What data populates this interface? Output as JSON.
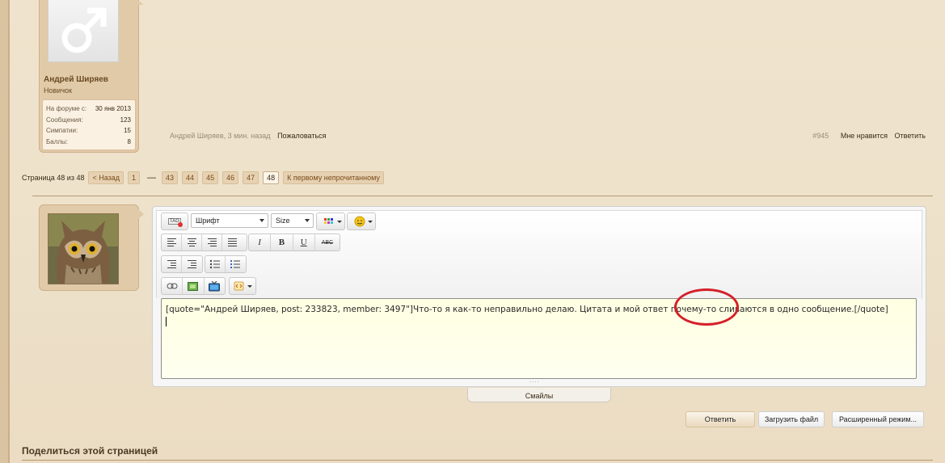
{
  "user": {
    "name": "Андрей Ширяев",
    "title": "Новичок",
    "stats": [
      {
        "label": "На форуме с:",
        "value": "30 янв 2013"
      },
      {
        "label": "Сообщения:",
        "value": "123"
      },
      {
        "label": "Симпатии:",
        "value": "15"
      },
      {
        "label": "Баллы:",
        "value": "8"
      }
    ]
  },
  "post": {
    "meta": "Андрей Ширяев, 3 мин. назад",
    "report": "Пожаловаться",
    "number": "#945",
    "like": "Мне нравится",
    "reply": "Ответить"
  },
  "pagination": {
    "label": "Страница 48 из 48",
    "prev": "< Назад",
    "first": "1",
    "pages": [
      "43",
      "44",
      "45",
      "46",
      "47",
      "48"
    ],
    "current": "48",
    "unread": "К первому непрочитанному"
  },
  "editor": {
    "font_select": "Шрифт",
    "size_select": "Size",
    "tag_icon_label": "TAG",
    "content": "[quote=\"Андрей Ширяев, post: 233823, member: 3497\"]Что-то я как-то неправильно делаю. Цитата и мой ответ почему-то сливаются в одно сообщение.[/quote]",
    "grip": "....",
    "smileys": "Смайлы",
    "bold": "B",
    "italic": "I",
    "underline": "U",
    "strike": "ABC"
  },
  "buttons": {
    "reply": "Ответить",
    "upload": "Загрузить файл",
    "advanced": "Расширенный режим..."
  },
  "footer": {
    "share": "Поделиться этой страницей"
  },
  "colors": {
    "highlight_ellipse": "#d4202a",
    "background": "#efe3cd"
  }
}
